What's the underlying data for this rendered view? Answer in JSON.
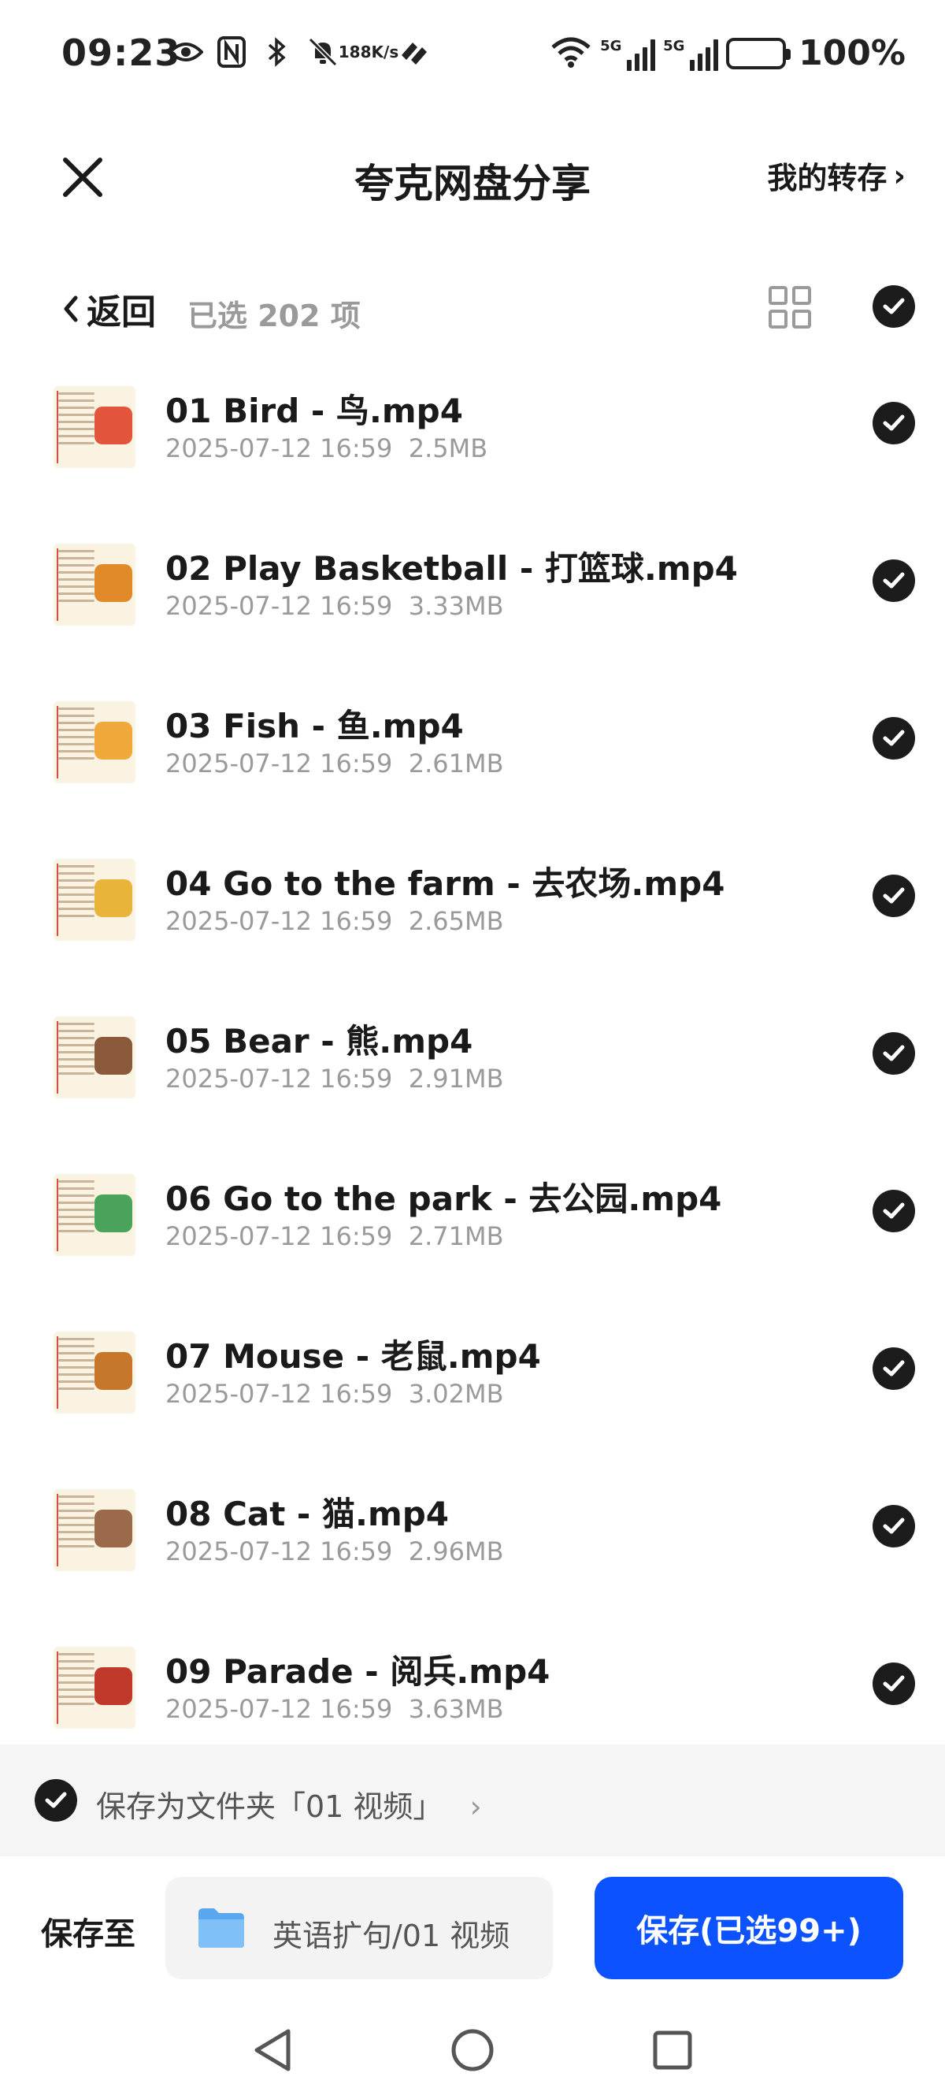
{
  "status_bar": {
    "time": "09:23",
    "net_speed_value": "188",
    "net_speed_unit": "K/s",
    "sim1_label": "5G",
    "sim2_label": "5G",
    "battery_percent": "100%"
  },
  "header": {
    "title": "夸克网盘分享",
    "my_transfer_label": "我的转存",
    "my_transfer_chevron": "›"
  },
  "subheader": {
    "back_label": "返回",
    "selected_label": "已选 202 项"
  },
  "files": [
    {
      "name": "01 Bird - 鸟.mp4",
      "date": "2025-07-12 16:59",
      "size": "2.5MB"
    },
    {
      "name": "02 Play Basketball - 打篮球.mp4",
      "date": "2025-07-12 16:59",
      "size": "3.33MB"
    },
    {
      "name": "03 Fish - 鱼.mp4",
      "date": "2025-07-12 16:59",
      "size": "2.61MB"
    },
    {
      "name": "04 Go to the farm - 去农场.mp4",
      "date": "2025-07-12 16:59",
      "size": "2.65MB"
    },
    {
      "name": "05 Bear - 熊.mp4",
      "date": "2025-07-12 16:59",
      "size": "2.91MB"
    },
    {
      "name": "06 Go to the park - 去公园.mp4",
      "date": "2025-07-12 16:59",
      "size": "2.71MB"
    },
    {
      "name": "07 Mouse - 老鼠.mp4",
      "date": "2025-07-12 16:59",
      "size": "3.02MB"
    },
    {
      "name": "08 Cat - 猫.mp4",
      "date": "2025-07-12 16:59",
      "size": "2.96MB"
    },
    {
      "name": "09 Parade - 阅兵.mp4",
      "date": "2025-07-12 16:59",
      "size": "3.63MB"
    }
  ],
  "folder_option": {
    "label": "保存为文件夹「01 视频」",
    "chevron": "›"
  },
  "save_bar": {
    "save_to_label": "保存至",
    "path": "英语扩句/01 视频",
    "save_button": "保存(已选99+)"
  },
  "colors": {
    "accent": "#0d52ff",
    "check_fill": "#1c1c1c",
    "muted_text": "#9a9a9a"
  }
}
